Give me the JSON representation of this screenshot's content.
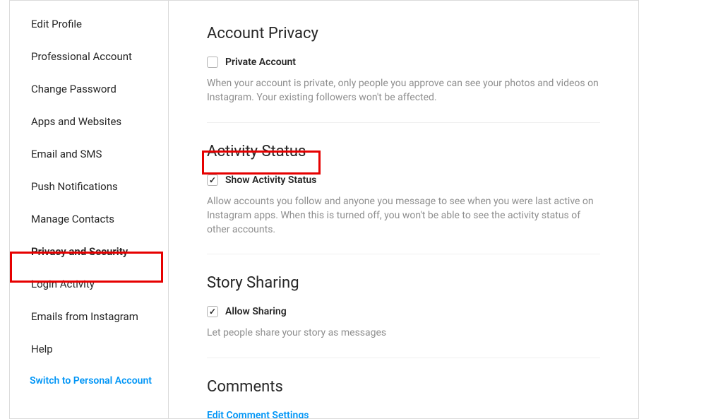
{
  "sidebar": {
    "items": [
      {
        "label": "Edit Profile"
      },
      {
        "label": "Professional Account"
      },
      {
        "label": "Change Password"
      },
      {
        "label": "Apps and Websites"
      },
      {
        "label": "Email and SMS"
      },
      {
        "label": "Push Notifications"
      },
      {
        "label": "Manage Contacts"
      },
      {
        "label": "Privacy and Security"
      },
      {
        "label": "Login Activity"
      },
      {
        "label": "Emails from Instagram"
      },
      {
        "label": "Help"
      }
    ],
    "switch_link": "Switch to Personal Account"
  },
  "sections": {
    "account_privacy": {
      "title": "Account Privacy",
      "checkbox_label": "Private Account",
      "checked": false,
      "help": "When your account is private, only people you approve can see your photos and videos on Instagram. Your existing followers won't be affected."
    },
    "activity_status": {
      "title": "Activity Status",
      "checkbox_label": "Show Activity Status",
      "checked": true,
      "help": "Allow accounts you follow and anyone you message to see when you were last active on Instagram apps. When this is turned off, you won't be able to see the activity status of other accounts."
    },
    "story_sharing": {
      "title": "Story Sharing",
      "checkbox_label": "Allow Sharing",
      "checked": true,
      "help": "Let people share your story as messages"
    },
    "comments": {
      "title": "Comments",
      "link": "Edit Comment Settings"
    }
  },
  "colors": {
    "accent": "#0095f6",
    "annotation": "#e60000",
    "text_muted": "#8e8e8e",
    "border": "#dbdbdb"
  }
}
